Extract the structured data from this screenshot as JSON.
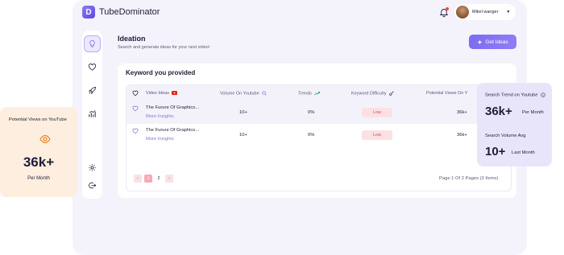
{
  "app": {
    "brand": "TubeDominator",
    "logo_letter": "D"
  },
  "user": {
    "name": "Mikel wanger"
  },
  "page": {
    "title": "Ideation",
    "subtitle": "Search and generate ideas for your next video!",
    "get_ideas_label": "Get Ideas"
  },
  "card": {
    "title": "Keyword you provided"
  },
  "table": {
    "headers": [
      "Video Ideas",
      "Volume On Youtube",
      "Trends",
      "Keyword Difficulty",
      "Potential Views On Y"
    ],
    "rows": [
      {
        "idea": "The Furure Of Graphics...",
        "insight": "More Insights",
        "volume": "10+",
        "trend": "0%",
        "difficulty": "Low",
        "views": "36k+"
      },
      {
        "idea": "The Furure Of Graphics...",
        "insight": "More Insights",
        "volume": "10+",
        "trend": "0%",
        "difficulty": "Low",
        "views": "36k+"
      }
    ]
  },
  "pagination": {
    "pages": [
      "1",
      "2"
    ],
    "current": "1",
    "prev": "‹",
    "next": "›",
    "info": "Page 1 Of 2 Pages (3 Items)"
  },
  "left_card": {
    "title": "Potential Views on YouTube",
    "value": "36k+",
    "per": "Per Month"
  },
  "right_card": {
    "trend_label": "Search Trend on Youtube",
    "trend_value": "36k+",
    "trend_unit": "Per Month",
    "volume_label": "Search Volume Avg",
    "volume_value": "10+",
    "volume_unit": "Last Month"
  },
  "colors": {
    "accent": "#7d6cf0",
    "low_badge": "#fde0e4",
    "low_text": "#e0475e",
    "peach": "#fdeee0",
    "lavender": "#e8e5fb"
  }
}
